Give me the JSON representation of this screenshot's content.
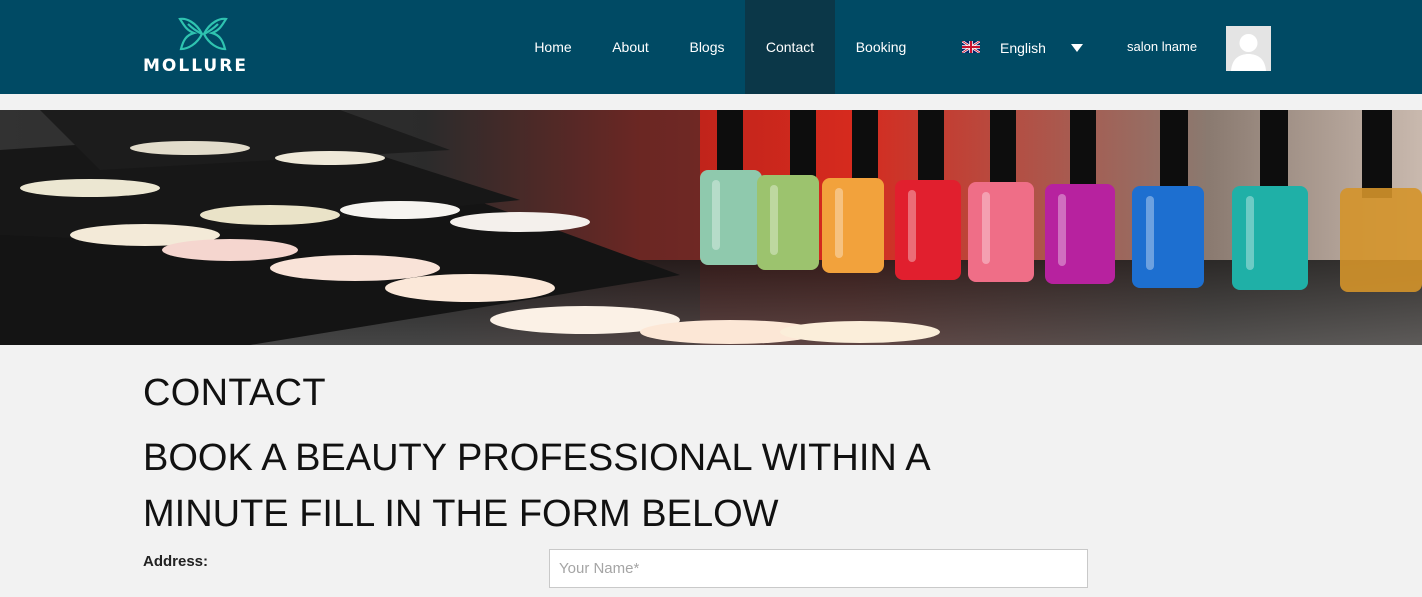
{
  "brand": {
    "name": "MOLLURE",
    "logo_icon": "butterfly-icon",
    "accent": "#2fc3b0"
  },
  "colors": {
    "header_bg": "#004a64",
    "active_nav_bg": "#0b3748",
    "page_bg": "#f2f2f2"
  },
  "nav": {
    "items": [
      {
        "label": "Home"
      },
      {
        "label": "About"
      },
      {
        "label": "Blogs"
      },
      {
        "label": "Contact",
        "active": true
      },
      {
        "label": "Booking"
      }
    ]
  },
  "language": {
    "selected": "English",
    "flag_icon": "uk-flag-icon",
    "dropdown_icon": "caret-down-icon"
  },
  "user": {
    "name": "salon lname",
    "avatar_icon": "user-avatar-icon"
  },
  "hero": {
    "image": "nail-polish-and-eyeshadow-banner"
  },
  "content": {
    "title": "CONTACT",
    "subtitle_line1": "BOOK A BEAUTY PROFESSIONAL WITHIN A",
    "subtitle_line2": "MINUTE FILL IN THE FORM BELOW",
    "address_label": "Address:",
    "name_placeholder": "Your Name*"
  }
}
